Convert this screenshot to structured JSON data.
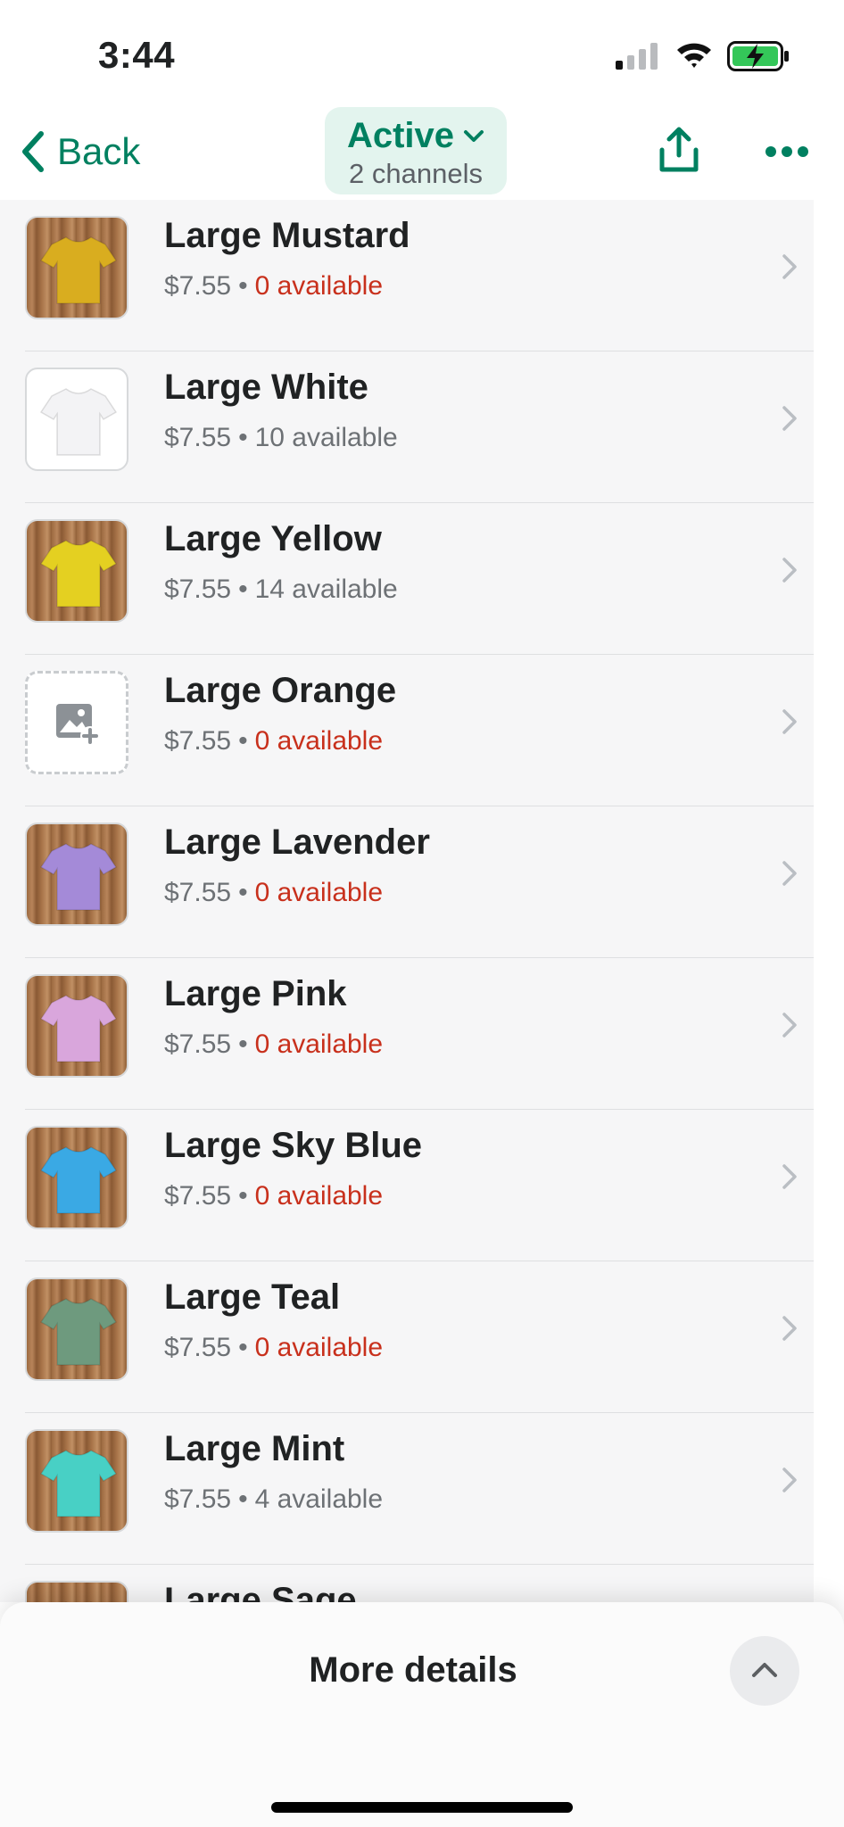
{
  "status_bar": {
    "time": "3:44",
    "battery_color": "#34c759"
  },
  "nav": {
    "back_label": "Back",
    "status_label": "Active",
    "channels_label": "2 channels",
    "accent_color": "#008060"
  },
  "variants": [
    {
      "title": "Large Mustard",
      "price": "$7.55",
      "availability": "0 available",
      "zero": true,
      "image": "tshirt",
      "shirt_color": "#d9ad1f"
    },
    {
      "title": "Large White",
      "price": "$7.55",
      "availability": "10 available",
      "zero": false,
      "image": "tshirt-white",
      "shirt_color": "#f3f3f5"
    },
    {
      "title": "Large Yellow",
      "price": "$7.55",
      "availability": "14 available",
      "zero": false,
      "image": "tshirt",
      "shirt_color": "#e4d021"
    },
    {
      "title": "Large Orange",
      "price": "$7.55",
      "availability": "0 available",
      "zero": true,
      "image": "placeholder",
      "shirt_color": ""
    },
    {
      "title": "Large Lavender",
      "price": "$7.55",
      "availability": "0 available",
      "zero": true,
      "image": "tshirt",
      "shirt_color": "#a48ad8"
    },
    {
      "title": "Large Pink",
      "price": "$7.55",
      "availability": "0 available",
      "zero": true,
      "image": "tshirt",
      "shirt_color": "#d9a6dc"
    },
    {
      "title": "Large Sky Blue",
      "price": "$7.55",
      "availability": "0 available",
      "zero": true,
      "image": "tshirt",
      "shirt_color": "#3aa9e4"
    },
    {
      "title": "Large Teal",
      "price": "$7.55",
      "availability": "0 available",
      "zero": true,
      "image": "tshirt",
      "shirt_color": "#6e9a7e"
    },
    {
      "title": "Large Mint",
      "price": "$7.55",
      "availability": "4 available",
      "zero": false,
      "image": "tshirt",
      "shirt_color": "#48d0c5"
    },
    {
      "title": "Large Sage",
      "price": "",
      "availability": "",
      "zero": false,
      "image": "tshirt",
      "shirt_color": "#b5bab0"
    }
  ],
  "sheet": {
    "title": "More details"
  }
}
